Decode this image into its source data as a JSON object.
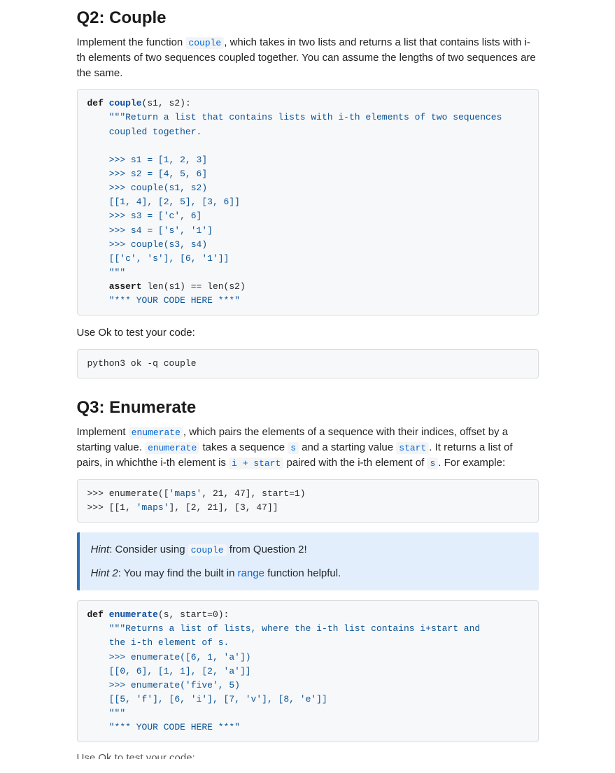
{
  "q2": {
    "heading": "Q2: Couple",
    "intro_pre": "Implement the function ",
    "intro_code": "couple",
    "intro_post": ", which takes in two lists and returns a list that contains lists with i-th elements of two sequences coupled together. You can assume the lengths of two sequences are the same.",
    "code": {
      "def_kw": "def",
      "fn_name": "couple",
      "sig_tail": "(s1, s2):",
      "doc1": "\"\"\"Return a list that contains lists with i-th elements of two sequences",
      "doc2": "coupled together.",
      "l1": ">>> s1 = [1, 2, 3]",
      "l2": ">>> s2 = [4, 5, 6]",
      "l3": ">>> couple(s1, s2)",
      "l4": "[[1, 4], [2, 5], [3, 6]]",
      "l5": ">>> s3 = ['c', 6]",
      "l6": ">>> s4 = ['s', '1']",
      "l7": ">>> couple(s3, s4)",
      "l8": "[['c', 's'], [6, '1']]",
      "l9": "\"\"\"",
      "assert_kw": "assert",
      "assert_tail": " len(s1) == len(s2)",
      "placeholder": "\"*** YOUR CODE HERE ***\""
    },
    "test_label": "Use Ok to test your code:",
    "test_cmd": "python3 ok -q couple"
  },
  "q3": {
    "heading": "Q3: Enumerate",
    "p1a": "Implement ",
    "p1_code1": "enumerate",
    "p1b": ", which pairs the elements of a sequence with their indices, offset by a starting value. ",
    "p1_code2": "enumerate",
    "p1c": " takes a sequence ",
    "p1_code3": "s",
    "p1d": " and a starting value ",
    "p1_code4": "start",
    "p1e": ". It returns a list of pairs, in whichthe i-th element is ",
    "p1_code5": "i + start",
    "p1f": " paired with the i-th element of ",
    "p1_code6": "s",
    "p1g": ". For example:",
    "example": {
      "l1_a": ">>> enumerate([",
      "l1_b": "'maps'",
      "l1_c": ", 21, 47], start=1)",
      "l2_a": ">>> [[1, ",
      "l2_b": "'maps'",
      "l2_c": "], [2, 21], [3, 47]]"
    },
    "hint1_pre": ": Consider using ",
    "hint1_strong": "Hint",
    "hint1_code": "couple",
    "hint1_post": " from Question 2!",
    "hint2_strong": "Hint 2",
    "hint2_pre": ": You may find the built in ",
    "hint2_link": "range",
    "hint2_post": " function helpful.",
    "code": {
      "def_kw": "def",
      "fn_name": "enumerate",
      "sig_tail": "(s, start=0):",
      "doc1": "\"\"\"Returns a list of lists, where the i-th list contains i+start and",
      "doc2": "the i-th element of s.",
      "l1": ">>> enumerate([6, 1, 'a'])",
      "l2": "[[0, 6], [1, 1], [2, 'a']]",
      "l3": ">>> enumerate('five', 5)",
      "l4": "[[5, 'f'], [6, 'i'], [7, 'v'], [8, 'e']]",
      "l5": "\"\"\"",
      "placeholder": "\"*** YOUR CODE HERE ***\""
    },
    "cutoff": "Use Ok to test your code:"
  }
}
